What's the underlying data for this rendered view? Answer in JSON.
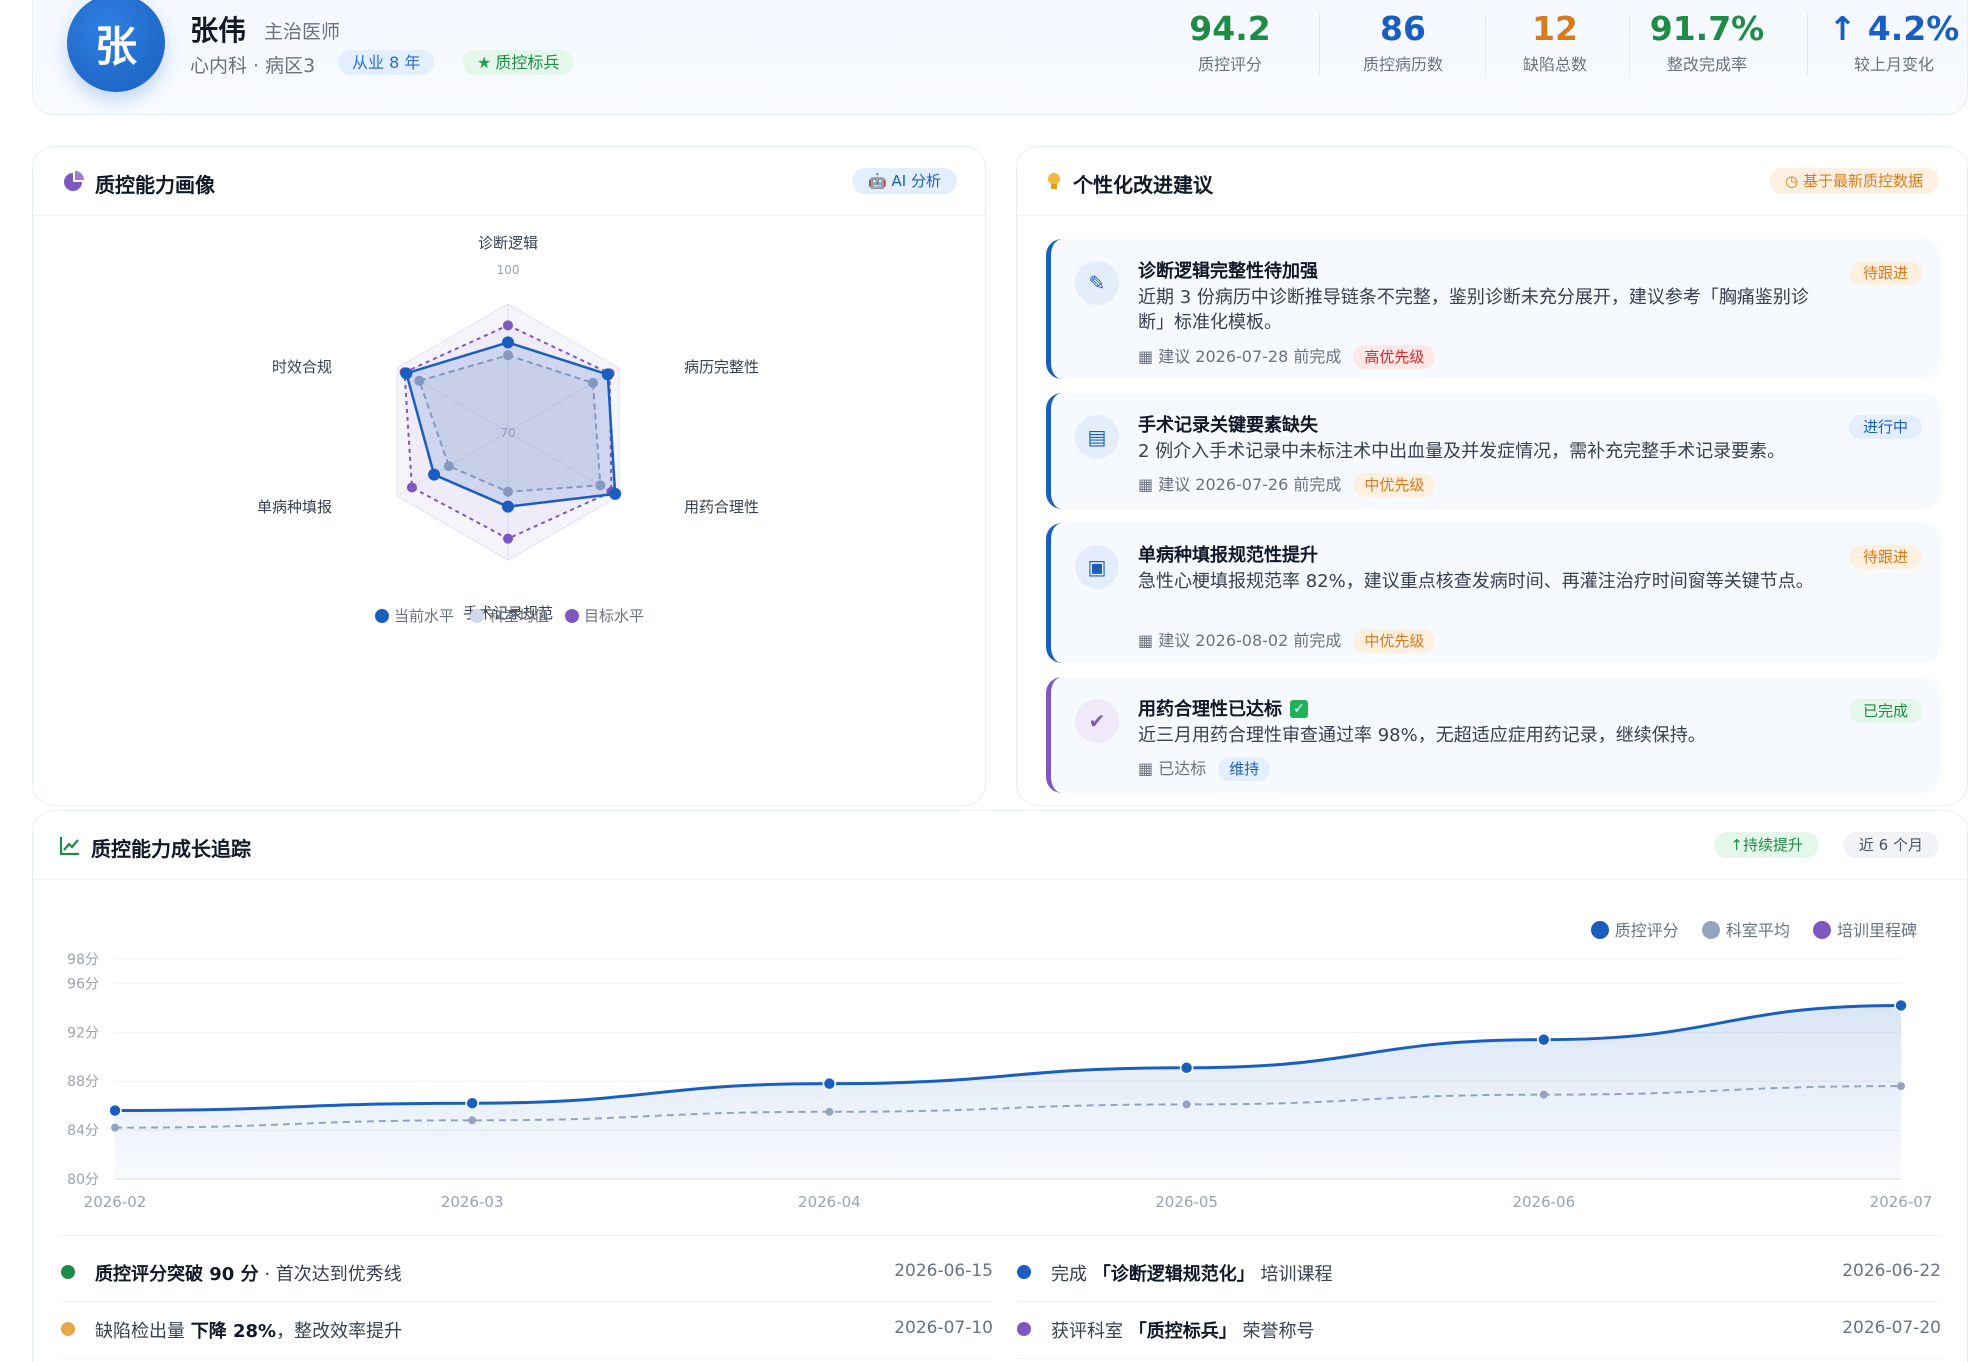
{
  "header": {
    "avatar_char": "张",
    "name": "张伟",
    "title": "主治医师",
    "dept": "心内科 · 病区3",
    "years_badge": "从业 8 年",
    "honor_badge": "质控标兵",
    "stats": [
      {
        "value": "94.2",
        "label": "质控评分",
        "color": "#1e8c45"
      },
      {
        "value": "86",
        "label": "质控病历数",
        "color": "#1a5fc0"
      },
      {
        "value": "12",
        "label": "缺陷总数",
        "color": "#d97a1e"
      },
      {
        "value": "91.7%",
        "label": "整改完成率",
        "color": "#1e8c45"
      },
      {
        "value": "↑ 4.2%",
        "label": "较上月变化",
        "color": "#1a5fc0"
      }
    ]
  },
  "radar_card": {
    "title": "质控能力画像",
    "tag": "AI 分析",
    "tag_icon": "robot-icon"
  },
  "suggestions_card": {
    "title": "个性化改进建议",
    "tag": "基于最新质控数据",
    "tag_icon": "clock-icon",
    "items": [
      {
        "icon": "pencil-icon",
        "title": "诊断逻辑完整性待加强",
        "desc": "近期 3 份病历中诊断推导链条不完整，鉴别诊断未充分展开，建议参考「胸痛鉴别诊断」标准化模板。",
        "meta": "建议 2026-07-28 前完成",
        "priority": "高优先级",
        "priority_color": "#dc2626",
        "priority_bg": "#fde8e8",
        "status": "待跟进",
        "status_color": "#d97a1e",
        "status_bg": "#fdf0e0"
      },
      {
        "icon": "document-icon",
        "title": "手术记录关键要素缺失",
        "desc": "2 例介入手术记录中未标注术中出血量及并发症情况，需补充完整手术记录要素。",
        "meta": "建议 2026-07-26 前完成",
        "priority": "中优先级",
        "priority_color": "#d97a1e",
        "priority_bg": "#fdf0e0",
        "status": "进行中",
        "status_color": "#1a5fc0",
        "status_bg": "#e3eeff"
      },
      {
        "icon": "clipboard-icon",
        "title": "单病种填报规范性提升",
        "desc": "急性心梗填报规范率 82%，建议重点核查发病时间、再灌注治疗时间窗等关键节点。",
        "meta": "建议 2026-08-02 前完成",
        "priority": "中优先级",
        "priority_color": "#d97a1e",
        "priority_bg": "#fdf0e0",
        "status": "待跟进",
        "status_color": "#d97a1e",
        "status_bg": "#fdf0e0"
      },
      {
        "icon": "double-check-icon",
        "title": "用药合理性已达标",
        "desc": "近三月用药合理性审查通过率 98%，无超适应症用药记录，继续保持。",
        "meta": "已达标",
        "priority": "维持",
        "priority_color": "#1a5fc0",
        "priority_bg": "#e3eeff",
        "status": "已完成",
        "status_color": "#1e8c45",
        "status_bg": "#e5f6ea"
      }
    ]
  },
  "growth_card": {
    "title": "质控能力成长追踪",
    "tag_up": "持续提升",
    "tag_period": "近 6 个月",
    "milestones": [
      {
        "dot": "#1e8c45",
        "bold": "质控评分突破 90 分",
        "rest": " · 首次达到优秀线",
        "date": "2026-06-15"
      },
      {
        "dot": "#1a5fc0",
        "pre": "完成 ",
        "bold": "「诊断逻辑规范化」",
        "rest": " 培训课程",
        "date": "2026-06-22"
      },
      {
        "dot": "#e8a84a",
        "pre": "缺陷检出量 ",
        "bold": "下降 28%",
        "rest": "，整改效率提升",
        "date": "2026-07-10"
      },
      {
        "dot": "#7e57c2",
        "pre": "获评科室 ",
        "bold": "「质控标兵」",
        "rest": " 荣誉称号",
        "date": "2026-07-20"
      }
    ]
  },
  "chart_data": [
    {
      "type": "radar",
      "axes": [
        "诊断逻辑",
        "病历完整性",
        "用药合理性",
        "手术记录规范",
        "单病种填报",
        "时效合规"
      ],
      "scale_labels": [
        "100",
        "70"
      ],
      "range": [
        40,
        100
      ],
      "series": [
        {
          "name": "当前水平",
          "color": "#1a5fc0",
          "values": [
            82,
            94,
            98,
            75,
            80,
            95
          ]
        },
        {
          "name": "科室均值",
          "color": "#94a3c0",
          "values": [
            76,
            86,
            90,
            68,
            72,
            88
          ]
        },
        {
          "name": "目标水平",
          "color": "#7e57c2",
          "values": [
            90,
            95,
            96,
            90,
            92,
            96
          ]
        }
      ]
    },
    {
      "type": "line",
      "x": [
        "2026-02",
        "2026-03",
        "2026-04",
        "2026-05",
        "2026-06",
        "2026-07"
      ],
      "yticks": [
        "98分",
        "96分",
        "92分",
        "88分",
        "84分",
        "80分"
      ],
      "ylim": [
        80,
        98
      ],
      "grid": true,
      "legend_position": "top-right",
      "legend": [
        {
          "name": "质控评分",
          "color": "#1a5fc0"
        },
        {
          "name": "科室平均",
          "color": "#94a3c0"
        },
        {
          "name": "培训里程碑",
          "color": "#7e57c2"
        }
      ],
      "series": [
        {
          "name": "质控评分",
          "color": "#1a5fc0",
          "values": [
            85.6,
            86.2,
            87.8,
            89.1,
            91.4,
            94.2
          ]
        },
        {
          "name": "科室平均",
          "color": "#94a3c0",
          "values": [
            84.2,
            84.8,
            85.5,
            86.1,
            86.9,
            87.6
          ]
        }
      ]
    }
  ]
}
